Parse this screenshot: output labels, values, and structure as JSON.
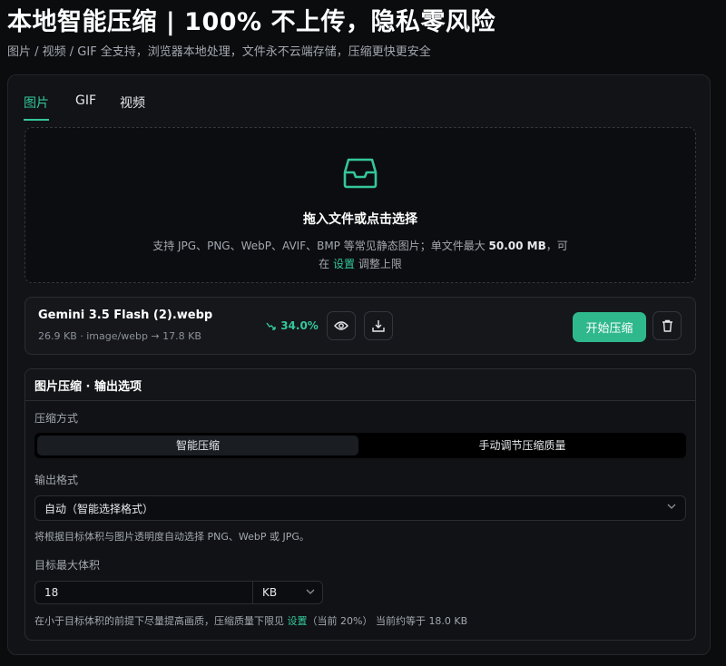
{
  "hero": {
    "title": "本地智能压缩 | 100% 不上传，隐私零风险",
    "subtitle": "图片 / 视频 / GIF 全支持，浏览器本地处理，文件永不云端存储，压缩更快更安全"
  },
  "tabs": [
    {
      "label": "图片",
      "active": true
    },
    {
      "label": "GIF",
      "active": false
    },
    {
      "label": "视频",
      "active": false
    }
  ],
  "dropzone": {
    "title": "拖入文件或点击选择",
    "desc_prefix": "支持 JPG、PNG、WebP、AVIF、BMP 等常见静态图片；单文件最大 ",
    "max_size": "50.00 MB",
    "desc_suffix": "，可",
    "line2_prefix": "在 ",
    "settings_link": "设置",
    "line2_suffix": " 调整上限"
  },
  "file": {
    "name": "Gemini 3.5 Flash (2).webp",
    "meta": "26.9 KB · image/webp → 17.8 KB",
    "ratio": "34.0%",
    "start_label": "开始压缩"
  },
  "options": {
    "title": "图片压缩 · 输出选项",
    "mode_label": "压缩方式",
    "mode_smart": "智能压缩",
    "mode_manual": "手动调节压缩质量",
    "format_label": "输出格式",
    "format_value": "自动（智能选择格式）",
    "format_hint": "将根据目标体积与图片透明度自动选择 PNG、WebP 或 JPG。",
    "size_label": "目标最大体积",
    "size_value": "18",
    "size_unit": "KB",
    "size_hint_prefix": "在小于目标体积的前提下尽量提高画质，压缩质量下限见 ",
    "size_hint_link": "设置",
    "size_hint_suffix": "（当前 20%） 当前约等于 18.0 KB"
  },
  "colors": {
    "accent": "#34c79a",
    "button": "#2fb88c",
    "background": "#0b0c0e"
  }
}
